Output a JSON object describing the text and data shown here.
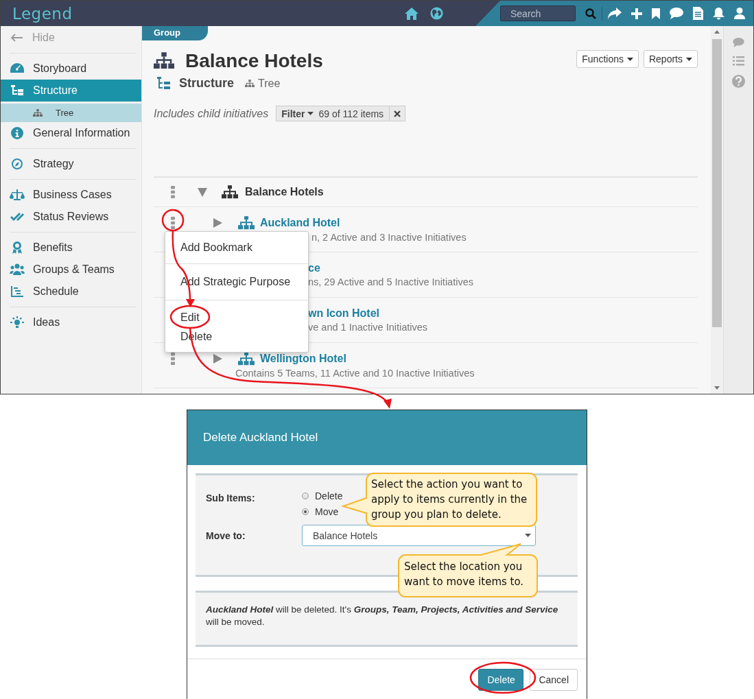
{
  "header": {
    "logo": "Legend",
    "search": {
      "placeholder": "Search"
    }
  },
  "sidebar": {
    "hide": "Hide",
    "sections": [
      [
        {
          "label": "Storyboard",
          "selected": false
        },
        {
          "label": "Structure",
          "selected": true,
          "children": [
            {
              "label": "Tree",
              "selected": true
            }
          ]
        },
        {
          "label": "General Information",
          "selected": false
        }
      ],
      [
        {
          "label": "Strategy",
          "selected": false
        }
      ],
      [
        {
          "label": "Business Cases",
          "selected": false
        },
        {
          "label": "Status Reviews",
          "selected": false
        }
      ],
      [
        {
          "label": "Benefits",
          "selected": false
        },
        {
          "label": "Groups & Teams",
          "selected": false
        },
        {
          "label": "Schedule",
          "selected": false
        }
      ],
      [
        {
          "label": "Ideas",
          "selected": false
        }
      ]
    ]
  },
  "page": {
    "tab": "Group",
    "title": "Balance Hotels",
    "view": "Structure",
    "subview": "Tree",
    "buttons": [
      "Functions",
      "Reports"
    ],
    "filter": {
      "note": "Includes child initiatives",
      "label": "Filter",
      "count": "69 of 112 items"
    }
  },
  "tree": {
    "root": {
      "title": "Balance Hotels",
      "expanded": true
    },
    "rows": [
      {
        "kind": "open-menu",
        "expanded": false,
        "title": "Auckland Hotel",
        "subtitle": "n, 2 Active and 3 Inactive Initiatives"
      },
      {
        "kind": "hidden",
        "title": "ce",
        "subtitle": "ns, 29 Active and 5 Inactive Initiatives"
      },
      {
        "kind": "hidden",
        "title": "wn Icon Hotel",
        "subtitle": "ve and 1 Inactive Initiatives"
      },
      {
        "kind": "plain",
        "expanded": false,
        "title": "Wellington Hotel",
        "subtitle": "Contains 5 Teams, 11 Active and 10 Inactive Initiatives"
      }
    ]
  },
  "context_menu": {
    "groups": [
      [
        "Add Bookmark"
      ],
      [
        "Add Strategic Purpose"
      ],
      [
        "Edit",
        "Delete"
      ]
    ]
  },
  "dialog": {
    "title": "Delete Auckland Hotel",
    "sub_items_label": "Sub Items:",
    "options": [
      {
        "label": "Delete",
        "selected": false
      },
      {
        "label": "Move",
        "selected": true
      }
    ],
    "move_to_label": "Move to:",
    "move_to": "Balance Hotels",
    "note": "**Auckland Hotel** will be deleted. It's **Groups, Team, Projects, Activities and Service** will be moved.",
    "buttons": [
      {
        "label": "Delete",
        "kind": "primary"
      },
      {
        "label": "Cancel",
        "kind": "default"
      }
    ]
  },
  "callouts": [
    "Select the action you want to apply to items currently in the group you plan to delete.",
    "Select the location you want to move items to."
  ]
}
